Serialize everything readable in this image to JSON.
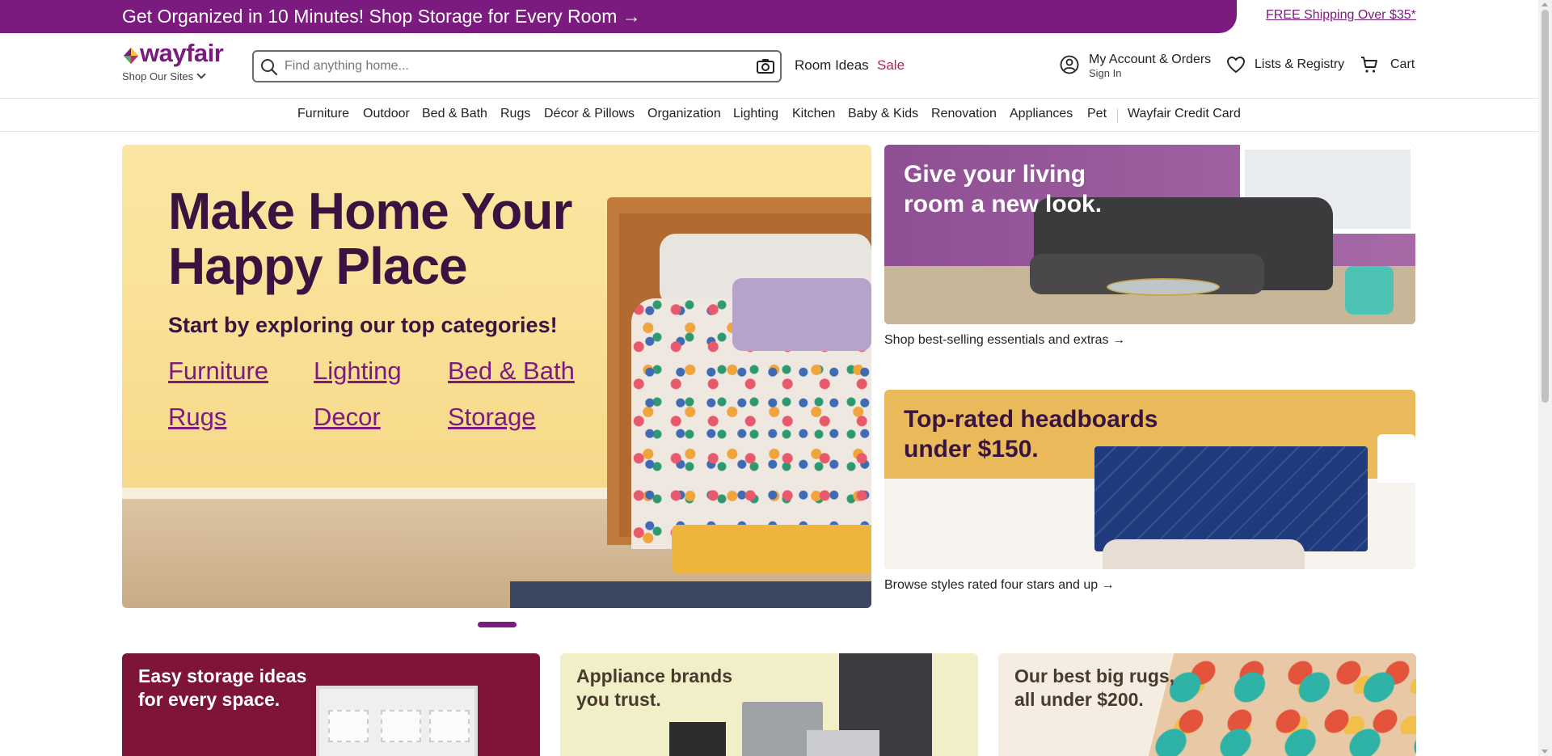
{
  "promo": {
    "text": "Get Organized in 10 Minutes! Shop Storage for Every Room →",
    "shipping_link": "FREE Shipping Over $35*",
    "color": "#7b1a7f"
  },
  "header": {
    "logo_text": "wayfair",
    "shop_sites": "Shop Our Sites",
    "search_placeholder": "Find anything home...",
    "room_ideas": "Room Ideas",
    "sale": "Sale",
    "account_title": "My Account & Orders",
    "account_sub": "Sign In",
    "lists": "Lists & Registry",
    "cart": "Cart"
  },
  "nav": {
    "items": [
      "Furniture",
      "Outdoor",
      "Bed & Bath",
      "Rugs",
      "Décor & Pillows",
      "Organization",
      "Lighting",
      "Kitchen",
      "Baby & Kids",
      "Renovation",
      "Appliances",
      "Pet"
    ],
    "credit_card": "Wayfair Credit Card"
  },
  "hero": {
    "title_line1": "Make Home Your",
    "title_line2": "Happy Place",
    "subtitle": "Start by exploring our top categories!",
    "links": [
      "Furniture",
      "Lighting",
      "Bed & Bath",
      "Rugs",
      "Decor",
      "Storage"
    ]
  },
  "side_cards": [
    {
      "title_line1": "Give your living",
      "title_line2": "room a new look.",
      "caption": "Shop best-selling essentials and extras →"
    },
    {
      "title_line1": "Top-rated headboards",
      "title_line2": "under $150.",
      "caption": "Browse styles rated four stars and up →"
    }
  ],
  "bottom_cards": [
    {
      "title_line1": "Easy storage ideas",
      "title_line2": "for every space."
    },
    {
      "title_line1": "Appliance brands",
      "title_line2": "you trust."
    },
    {
      "title_line1": "Our best big rugs,",
      "title_line2": "all under $200."
    }
  ],
  "colors": {
    "brand": "#7b1a7f",
    "sale": "#c11d4a",
    "hero_text": "#3a1440"
  }
}
